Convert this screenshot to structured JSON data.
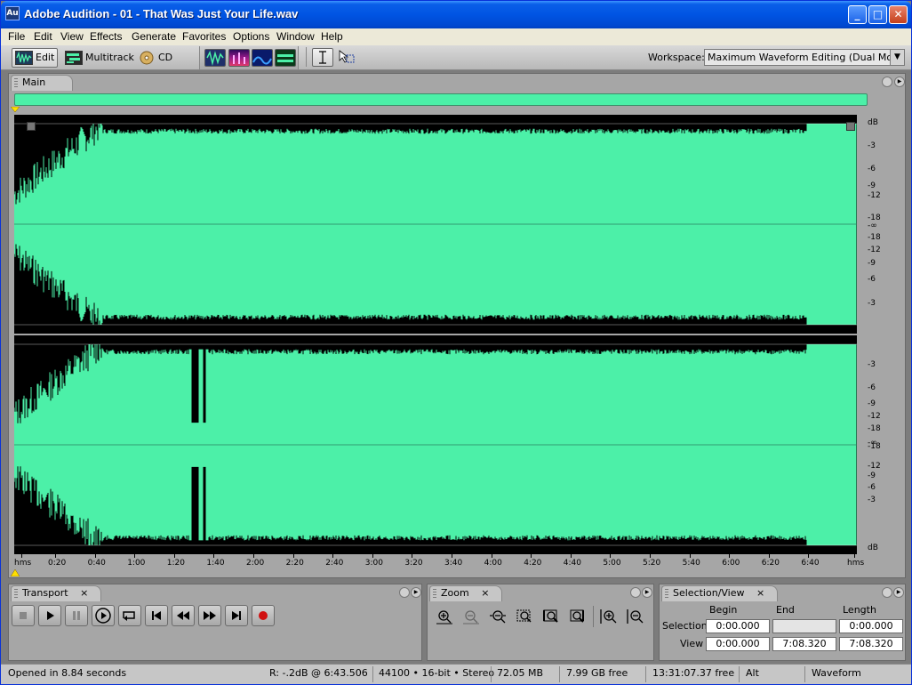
{
  "window": {
    "app_icon": "Au",
    "title": "Adobe Audition - 01 - That Was Just Your Life.wav",
    "controls": {
      "minimize": "_",
      "maximize": "□",
      "close": "✕"
    }
  },
  "menubar": [
    "File",
    "Edit",
    "View",
    "Effects",
    "Generate",
    "Favorites",
    "Options",
    "Window",
    "Help"
  ],
  "toolbar": {
    "modes": [
      {
        "label": "Edit",
        "icon": "edit-view-icon",
        "active": true
      },
      {
        "label": "Multitrack",
        "icon": "multitrack-view-icon",
        "active": false
      },
      {
        "label": "CD",
        "icon": "cd-view-icon",
        "active": false
      }
    ],
    "display_buttons": [
      "waveform-display-icon",
      "spectral-frequency-icon",
      "spectral-pan-icon",
      "spectral-phase-icon"
    ],
    "tools": [
      "time-selection-tool-icon",
      "marquee-tool-icon"
    ],
    "workspace_label": "Workspace:",
    "workspace_value": "Maximum Waveform Editing (Dual Monitor)"
  },
  "main_panel": {
    "tab_label": "Main",
    "db_scale_top": [
      "dB",
      "-3",
      "-6",
      "-9",
      "-12",
      "-18",
      "-∞",
      "-18",
      "-12",
      "-9",
      "-6",
      "-3"
    ],
    "db_scale_bottom": [
      "-3",
      "-6",
      "-9",
      "-12",
      "-18",
      "-∞",
      "-18",
      "-12",
      "-9",
      "-6",
      "-3",
      "dB"
    ],
    "time_labels": [
      "hms",
      "0:20",
      "0:40",
      "1:00",
      "1:20",
      "1:40",
      "2:00",
      "2:20",
      "2:40",
      "3:00",
      "3:20",
      "3:40",
      "4:00",
      "4:20",
      "4:40",
      "5:00",
      "5:20",
      "5:40",
      "6:00",
      "6:20",
      "6:40",
      "hms"
    ],
    "waveform_color": "#4cf0a8"
  },
  "transport": {
    "tab_label": "Transport",
    "close": "×",
    "buttons": [
      "stop-icon",
      "play-icon",
      "pause-icon",
      "play-to-end-icon",
      "loop-icon",
      "go-to-beginning-icon",
      "rewind-icon",
      "fast-forward-icon",
      "go-to-end-icon",
      "record-icon"
    ]
  },
  "zoom": {
    "tab_label": "Zoom",
    "close": "×",
    "buttons": [
      "zoom-in-horizontal-icon",
      "zoom-out-horizontal-icon",
      "zoom-out-full-icon",
      "zoom-to-selection-icon",
      "zoom-to-left-edge-icon",
      "zoom-to-right-edge-icon",
      "zoom-in-vertical-icon",
      "zoom-out-vertical-icon"
    ]
  },
  "selection_view": {
    "tab_label": "Selection/View",
    "close": "×",
    "headers": {
      "begin": "Begin",
      "end": "End",
      "length": "Length"
    },
    "selection": {
      "label": "Selection",
      "begin": "0:00.000",
      "end": "",
      "length": "0:00.000"
    },
    "view": {
      "label": "View",
      "begin": "0:00.000",
      "end": "7:08.320",
      "length": "7:08.320"
    }
  },
  "statusbar": {
    "opened": "Opened in 8.84 seconds",
    "level": "R: -.2dB @  6:43.506",
    "format": "44100 • 16-bit • Stereo",
    "size": "72.05 MB",
    "free": "7.99 GB free",
    "time_free": "13:31:07.37 free",
    "modifier": "Alt",
    "mode": "Waveform"
  }
}
